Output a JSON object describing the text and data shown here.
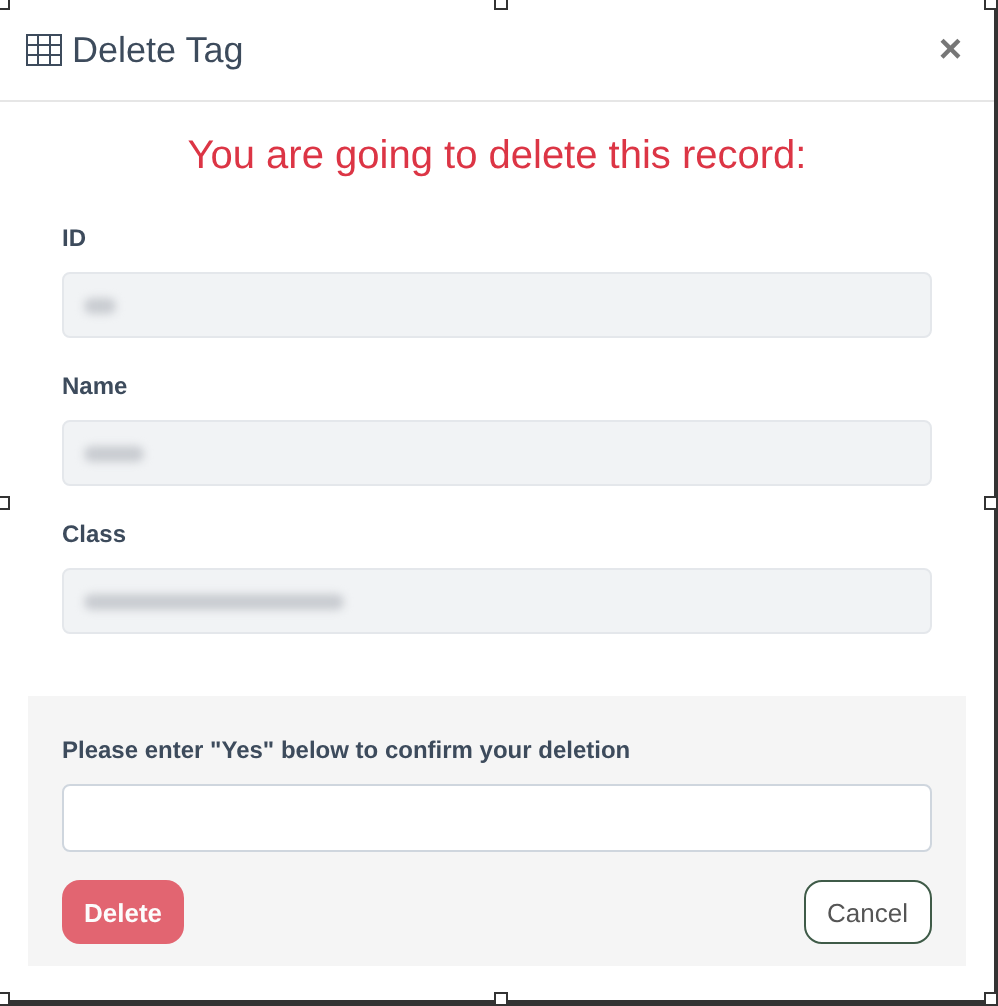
{
  "dialog": {
    "title": "Delete Tag",
    "close": "×"
  },
  "warning": "You are going to delete this record:",
  "fields": [
    {
      "label": "ID",
      "redacted": true
    },
    {
      "label": "Name",
      "redacted": true
    },
    {
      "label": "Class",
      "redacted": true
    }
  ],
  "confirm": {
    "prompt": "Please enter \"Yes\" below to confirm your deletion"
  },
  "buttons": [
    {
      "kind": "danger",
      "label": "Delete",
      "disabled": true
    },
    {
      "kind": "outline",
      "label": "Cancel",
      "disabled": false
    }
  ]
}
